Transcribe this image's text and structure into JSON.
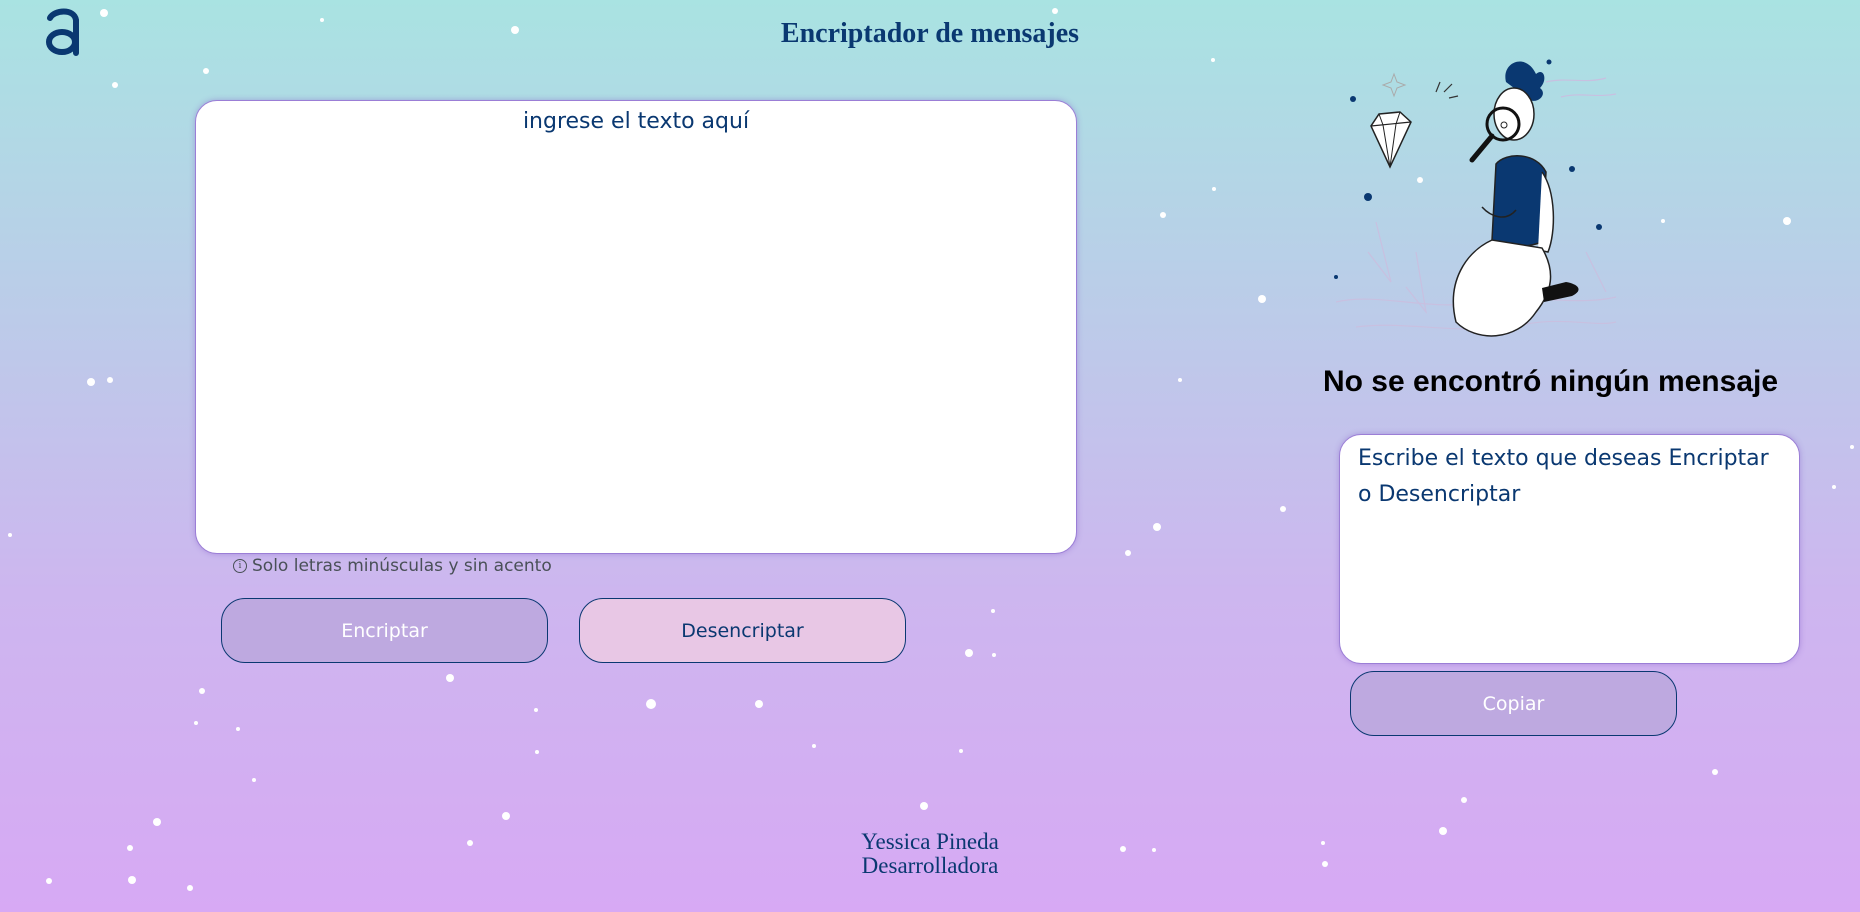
{
  "header": {
    "logo_text": "a",
    "title": "Encriptador de mensajes"
  },
  "input": {
    "placeholder": "ingrese el texto aquí",
    "value": ""
  },
  "hint": {
    "icon": "info-circle-icon",
    "text": "Solo letras minúsculas y sin acento"
  },
  "actions": {
    "encrypt_label": "Encriptar",
    "decrypt_label": "Desencriptar"
  },
  "output": {
    "heading": "No se encontró ningún mensaje",
    "text": "Escribe el texto que deseas Encriptar o Desencriptar",
    "copy_label": "Copiar"
  },
  "footer": {
    "name": "Yessica Pineda",
    "role": "Desarrolladora"
  },
  "colors": {
    "primary": "#0a3871",
    "button_primary_bg": "#bea9e0",
    "button_secondary_bg": "#e8c7e5",
    "gradient_top": "#a9e3e2",
    "gradient_bottom": "#d7a9f4"
  }
}
